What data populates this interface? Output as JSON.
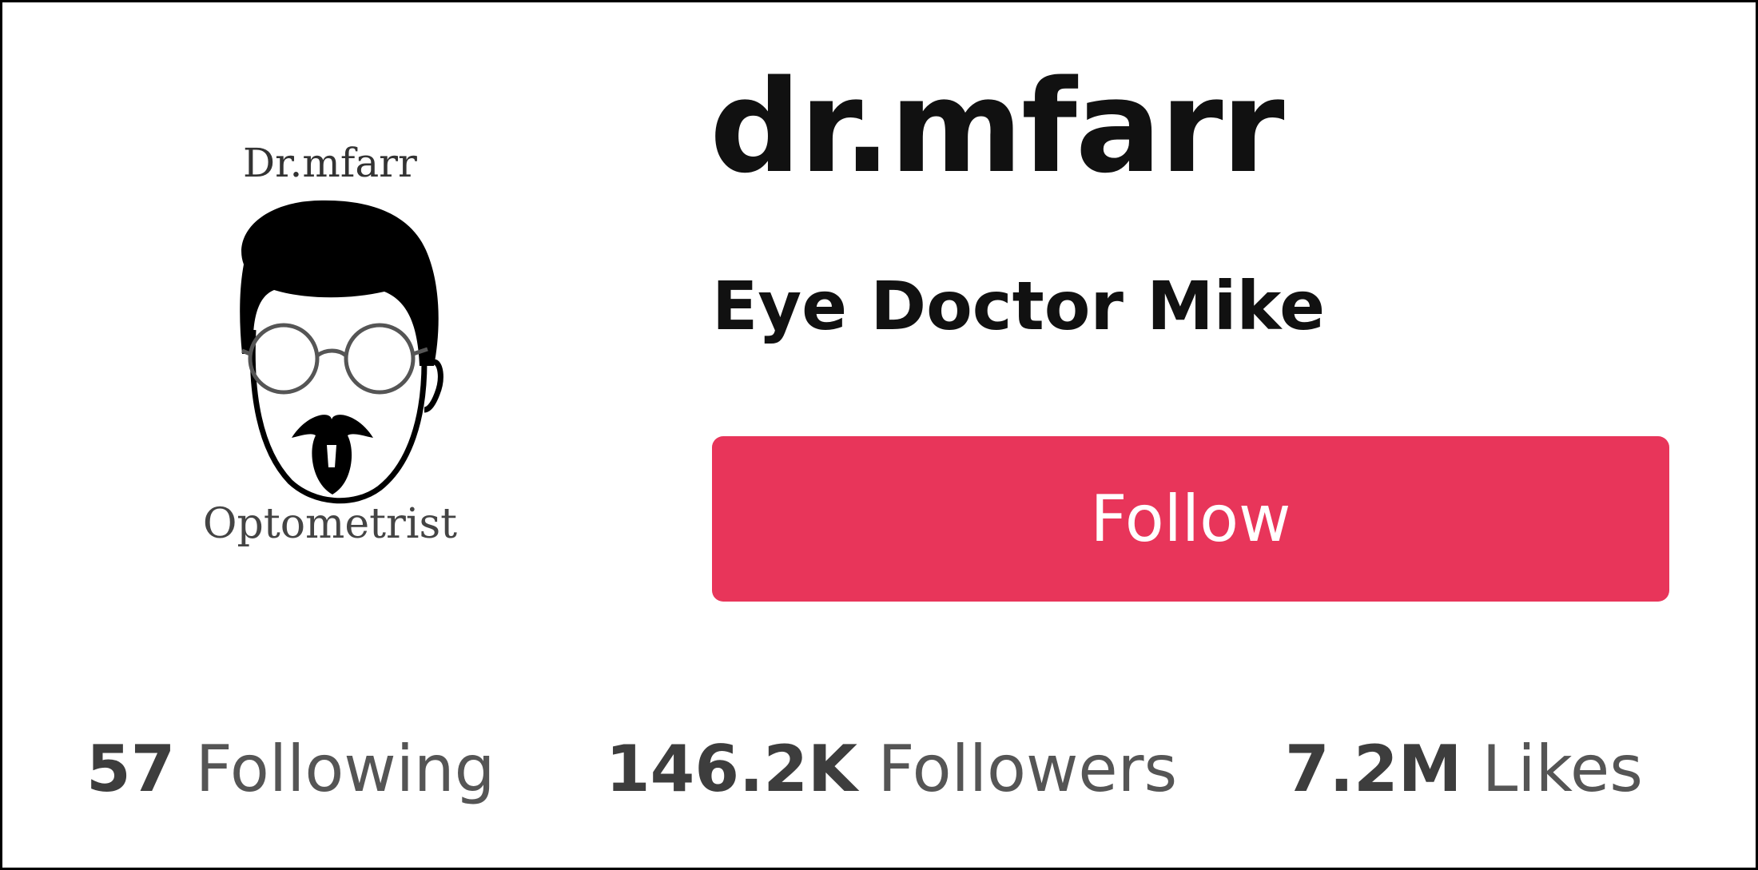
{
  "profile": {
    "avatar_top_text": "Dr.mfarr",
    "avatar_bottom_text": "Optometrist",
    "username": "dr.mfarr",
    "display_name": "Eye Doctor Mike"
  },
  "actions": {
    "follow_label": "Follow"
  },
  "stats": {
    "following": {
      "value": "57",
      "label": "Following"
    },
    "followers": {
      "value": "146.2K",
      "label": "Followers"
    },
    "likes": {
      "value": "7.2M",
      "label": "Likes"
    }
  },
  "colors": {
    "follow_button": "#e8355a",
    "text_primary": "#111111",
    "text_secondary": "#555555",
    "border": "#000000"
  }
}
